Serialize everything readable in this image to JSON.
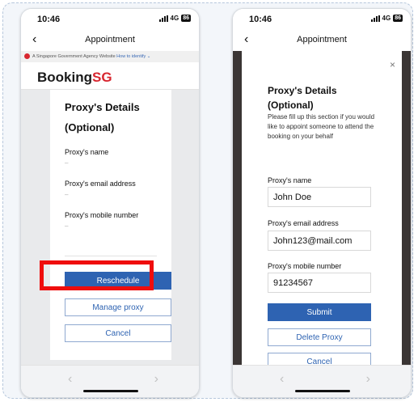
{
  "status_bar": {
    "time": "10:46",
    "network": "4G",
    "battery": "86"
  },
  "header": {
    "title": "Appointment"
  },
  "gov_banner": {
    "text": "A Singapore Government Agency Website",
    "link": "How to identify"
  },
  "brand": {
    "part1": "Booking",
    "part2": "SG"
  },
  "left_screen": {
    "heading_line1": "Proxy's Details",
    "heading_line2": "(Optional)",
    "fields": [
      {
        "label": "Proxy's name",
        "value": "–"
      },
      {
        "label": "Proxy's email address",
        "value": "–"
      },
      {
        "label": "Proxy's mobile number",
        "value": "–"
      }
    ],
    "buttons": {
      "reschedule": "Reschedule",
      "manage_proxy": "Manage proxy",
      "cancel": "Cancel"
    }
  },
  "right_screen": {
    "close_symbol": "×",
    "heading_line1": "Proxy's Details",
    "heading_line2": "(Optional)",
    "description": "Please fill up this section if you would like to appoint someone to attend the booking on your behalf",
    "fields": [
      {
        "label": "Proxy's name",
        "value": "John Doe"
      },
      {
        "label": "Proxy's email address",
        "value": "John123@mail.com"
      },
      {
        "label": "Proxy's mobile number",
        "value": "91234567"
      }
    ],
    "buttons": {
      "submit": "Submit",
      "delete_proxy": "Delete Proxy",
      "cancel": "Cancel"
    }
  },
  "bottom_nav": {
    "prev": "‹",
    "next": "›"
  },
  "colors": {
    "primary": "#2e63b2",
    "brand_red": "#d8262f",
    "highlight": "#ef0d0d",
    "modal_backdrop": "#3a3534"
  },
  "highlighted_element": "left_screen.buttons.manage_proxy"
}
